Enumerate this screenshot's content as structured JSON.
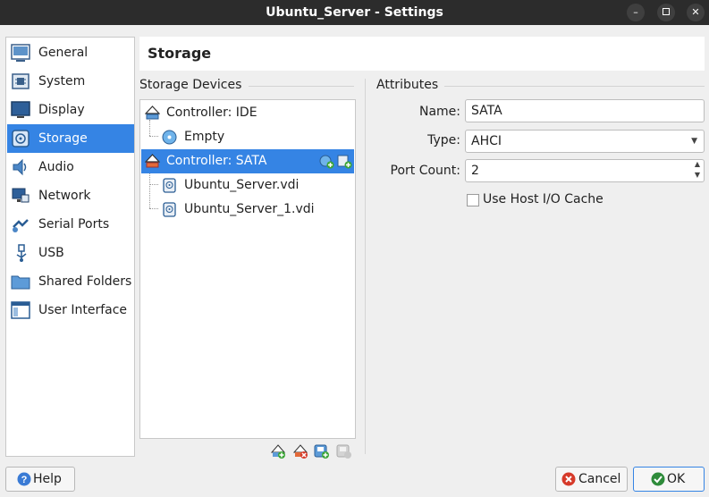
{
  "window": {
    "title": "Ubuntu_Server - Settings",
    "controls": [
      "minimize-icon",
      "maximize-icon",
      "close-icon"
    ]
  },
  "sidebar": {
    "items": [
      {
        "label": "General",
        "icon": "general-icon"
      },
      {
        "label": "System",
        "icon": "system-chip-icon"
      },
      {
        "label": "Display",
        "icon": "display-monitor-icon"
      },
      {
        "label": "Storage",
        "icon": "storage-disk-icon",
        "selected": true
      },
      {
        "label": "Audio",
        "icon": "audio-speaker-icon"
      },
      {
        "label": "Network",
        "icon": "network-icon"
      },
      {
        "label": "Serial Ports",
        "icon": "serial-port-icon"
      },
      {
        "label": "USB",
        "icon": "usb-icon"
      },
      {
        "label": "Shared Folders",
        "icon": "shared-folder-icon"
      },
      {
        "label": "User Interface",
        "icon": "user-interface-icon"
      }
    ]
  },
  "page": {
    "title": "Storage"
  },
  "storage_devices": {
    "group_label": "Storage Devices",
    "tree": [
      {
        "label": "Controller: IDE",
        "type": "controller",
        "icon": "ide-controller-icon"
      },
      {
        "label": "Empty",
        "type": "optical",
        "icon": "optical-disc-icon"
      },
      {
        "label": "Controller: SATA",
        "type": "controller",
        "icon": "sata-controller-icon",
        "selected": true
      },
      {
        "label": "Ubuntu_Server.vdi",
        "type": "disk",
        "icon": "hard-disk-icon"
      },
      {
        "label": "Ubuntu_Server_1.vdi",
        "type": "disk",
        "icon": "hard-disk-icon"
      }
    ],
    "row_actions": [
      "add-optical-drive-icon",
      "add-hard-disk-icon"
    ],
    "toolbar": [
      "add-controller-icon",
      "remove-controller-icon",
      "add-attachment-icon",
      "remove-attachment-icon"
    ]
  },
  "attributes": {
    "group_label": "Attributes",
    "name_label": "Name:",
    "name_value": "SATA",
    "type_label": "Type:",
    "type_value": "AHCI",
    "port_count_label": "Port Count:",
    "port_count_value": "2",
    "host_io_cache_label": "Use Host I/O Cache",
    "host_io_cache_checked": false
  },
  "buttons": {
    "help": "Help",
    "cancel": "Cancel",
    "ok": "OK"
  },
  "colors": {
    "selection": "#3584e4",
    "titlebar": "#2c2c2c"
  }
}
